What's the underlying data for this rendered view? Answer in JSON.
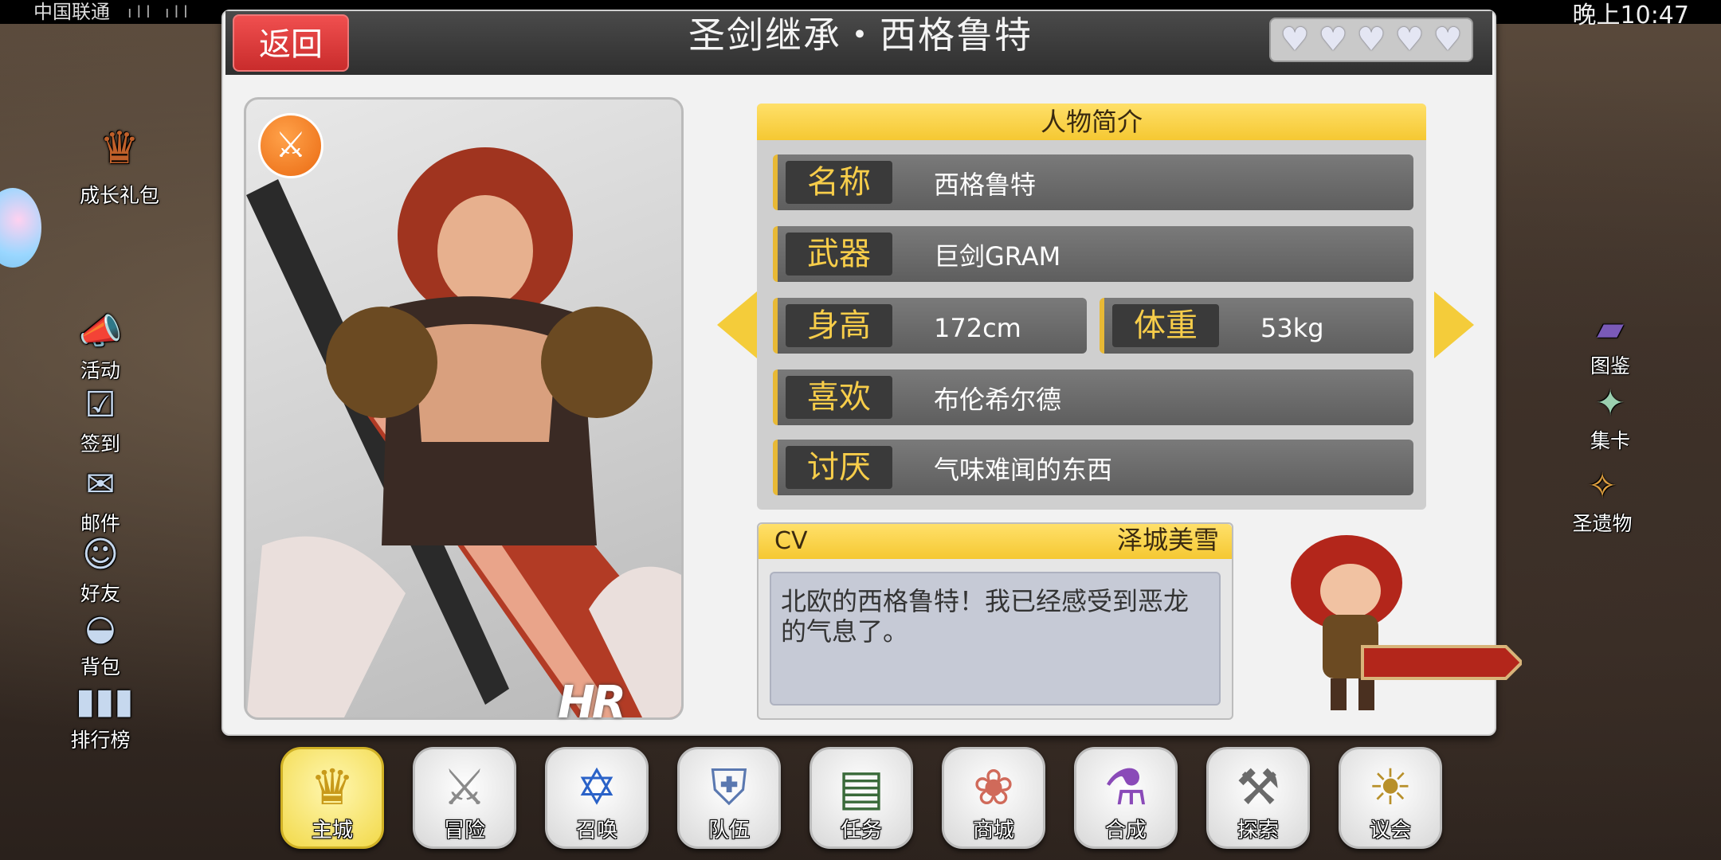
{
  "status_bar": {
    "carrier": "中国联通",
    "time": "晚上10:47",
    "signal_text": "ıll ıll"
  },
  "header": {
    "back_label": "返回",
    "title": "圣剑继承・西格鲁特",
    "hearts": 5
  },
  "side_menu": {
    "growth_pack": "成长礼包",
    "items": [
      {
        "label": "活动",
        "icon": "megaphone-icon"
      },
      {
        "label": "签到",
        "icon": "checkin-icon"
      },
      {
        "label": "邮件",
        "icon": "mail-icon"
      },
      {
        "label": "好友",
        "icon": "friends-icon"
      },
      {
        "label": "背包",
        "icon": "backpack-icon"
      },
      {
        "label": "排行榜",
        "icon": "ranking-icon"
      }
    ]
  },
  "right_menu": {
    "items": [
      {
        "label": "图鉴",
        "icon": "book-icon"
      },
      {
        "label": "集卡",
        "icon": "card-icon"
      },
      {
        "label": "圣遗物",
        "icon": "relic-icon"
      }
    ]
  },
  "portrait": {
    "rarity": "HR",
    "weapon_icon": "sword-icon"
  },
  "profile": {
    "header": "人物简介",
    "name": {
      "label": "名称",
      "value": "西格鲁特"
    },
    "weapon": {
      "label": "武器",
      "value": "巨剑GRAM"
    },
    "height": {
      "label": "身高",
      "value": "172cm"
    },
    "weight": {
      "label": "体重",
      "value": "53kg"
    },
    "likes": {
      "label": "喜欢",
      "value": "布伦希尔德"
    },
    "dislikes": {
      "label": "讨厌",
      "value": "气味难闻的东西"
    }
  },
  "cv": {
    "label": "CV",
    "name": "泽城美雪",
    "quote": "北欧的西格鲁特！我已经感受到恶龙的气息了。"
  },
  "bottom_nav": [
    {
      "label": "主城",
      "icon": "crown-icon",
      "active": true
    },
    {
      "label": "冒险",
      "icon": "swords-icon"
    },
    {
      "label": "召唤",
      "icon": "summon-card-icon"
    },
    {
      "label": "队伍",
      "icon": "team-shield-icon"
    },
    {
      "label": "任务",
      "icon": "quest-book-icon"
    },
    {
      "label": "商城",
      "icon": "shop-tree-icon"
    },
    {
      "label": "合成",
      "icon": "potion-icon"
    },
    {
      "label": "探索",
      "icon": "explore-icon"
    },
    {
      "label": "议会",
      "icon": "council-icon"
    }
  ],
  "colors": {
    "accent": "#f5c832",
    "back_button": "#e03a3a",
    "label_text": "#f7cd4a"
  }
}
